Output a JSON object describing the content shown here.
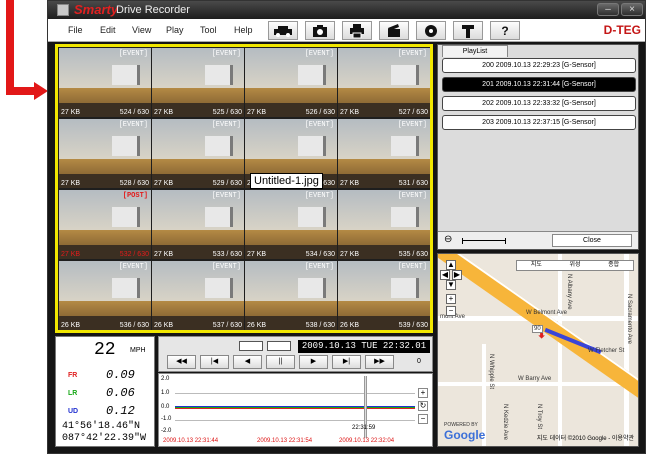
{
  "window": {
    "brand": "Smarty",
    "title": "Drive Recorder",
    "controls": [
      "–",
      "×"
    ]
  },
  "menu": [
    "File",
    "Edit",
    "View",
    "Play",
    "Tool",
    "Help"
  ],
  "toolbar": {
    "buttons": [
      "car-icon",
      "camera-icon",
      "printer-icon",
      "clapper-icon",
      "disc-icon",
      "wrench-icon",
      "help-icon"
    ],
    "help_label": "?",
    "brand": "D-TEG"
  },
  "thumbnails": [
    {
      "tag": "[EVENT]",
      "size": "27 KB",
      "frame": "524 / 630"
    },
    {
      "tag": "[EVENT]",
      "size": "27 KB",
      "frame": "525 / 630"
    },
    {
      "tag": "[EVENT]",
      "size": "27 KB",
      "frame": "526 / 630"
    },
    {
      "tag": "[EVENT]",
      "size": "27 KB",
      "frame": "527 / 630"
    },
    {
      "tag": "[EVENT]",
      "size": "27 KB",
      "frame": "528 / 630"
    },
    {
      "tag": "[EVENT]",
      "size": "27 KB",
      "frame": "529 / 630"
    },
    {
      "tag": "[EVENT]",
      "size": "27 KB",
      "frame": "530 / 630"
    },
    {
      "tag": "[EVENT]",
      "size": "27 KB",
      "frame": "531 / 630"
    },
    {
      "tag": "[POST]",
      "size": "27 KB",
      "frame": "532 / 630",
      "red": true
    },
    {
      "tag": "[EVENT]",
      "size": "27 KB",
      "frame": "533 / 630"
    },
    {
      "tag": "[EVENT]",
      "size": "27 KB",
      "frame": "534 / 630"
    },
    {
      "tag": "[EVENT]",
      "size": "27 KB",
      "frame": "535 / 630"
    },
    {
      "tag": "[EVENT]",
      "size": "26 KB",
      "frame": "536 / 630"
    },
    {
      "tag": "[EVENT]",
      "size": "26 KB",
      "frame": "537 / 630"
    },
    {
      "tag": "[EVENT]",
      "size": "26 KB",
      "frame": "538 / 630"
    },
    {
      "tag": "[EVENT]",
      "size": "26 KB",
      "frame": "539 / 630"
    }
  ],
  "tooltip": "Untitled-1.jpg",
  "playlist": {
    "tab": "PlayList",
    "items": [
      {
        "label": "200  2009.10.13 22:29:23 [G-Sensor]",
        "selected": false
      },
      {
        "label": "201  2009.10.13 22:31:44 [G-Sensor]",
        "selected": true
      },
      {
        "label": "202  2009.10.13 22:33:32 [G-Sensor]",
        "selected": false
      },
      {
        "label": "203  2009.10.13 22:37:15 [G-Sensor]",
        "selected": false
      }
    ],
    "zoom_minus": "⊖",
    "close": "Close"
  },
  "map": {
    "tabs": [
      "지도",
      "위성",
      "종합"
    ],
    "streets": [
      "W Belmont Ave",
      "W Fletcher St",
      "W Barry Ave",
      "N Sacramento Ave",
      "N Kedzie Ave",
      "N Troy St",
      "N Albany Ave",
      "N Whipple St",
      "mont Ave",
      "W Belmont Ave"
    ],
    "highway_label": "90",
    "logo": "Google",
    "copyright": "지도 데이터 ©2010 Google - 이용약관",
    "powered": "POWERED BY"
  },
  "speed": {
    "value": "22",
    "unit": "MPH",
    "g": [
      {
        "label": "FR",
        "value": "0.09",
        "color": "#e02020"
      },
      {
        "label": "LR",
        "value": "0.06",
        "color": "#18a818"
      },
      {
        "label": "UD",
        "value": "0.12",
        "color": "#2030d0"
      }
    ],
    "lat": "41°56'18.46\"N",
    "lon": "087°42'22.39\"W"
  },
  "playback": {
    "datetime": "2009.10.13 TUE 22:32.01",
    "buttons": [
      "◀◀",
      "|◀",
      "◀",
      "||",
      "▶",
      "▶|",
      "▶▶"
    ],
    "count": "0"
  },
  "graph": {
    "y_labels": [
      "2.0",
      "1.0",
      "0.0",
      "-1.0",
      "-2.0"
    ],
    "cursor_time": "22:31:59",
    "x_labels": [
      "2009.10.13 22:31:44",
      "2009.10.13 22:31:54",
      "2009.10.13 22:32:04"
    ],
    "side": [
      "+",
      "↻",
      "−"
    ]
  },
  "colors": {
    "highlight": "#f1e700",
    "arrow": "#e21818"
  }
}
